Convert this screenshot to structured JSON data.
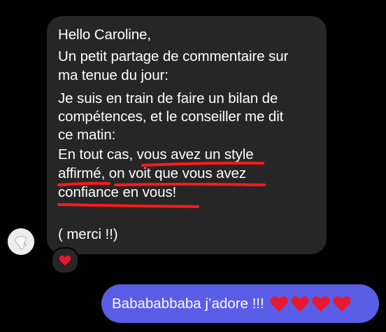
{
  "incoming": {
    "lines": [
      "Hello Caroline,",
      "Un petit partage de commentaire sur",
      "ma tenue du jour:",
      "Je suis en train de faire un bilan de",
      "compétences, et le conseiller me dit",
      "ce matin:",
      "En tout cas, vous avez un style",
      "affirmé, on voit que vous avez",
      "confiance en vous!",
      "( merci !!)"
    ],
    "reaction": "❤️"
  },
  "outgoing": {
    "text": "Babababbaba j’adore !!!",
    "hearts": [
      "❤️",
      "❤️",
      "❤️",
      "❤️"
    ]
  },
  "colors": {
    "incoming_bubble": "#262626",
    "outgoing_bubble": "#5a5de6",
    "underline": "#ff1a1a",
    "heart": "#e8182e"
  }
}
